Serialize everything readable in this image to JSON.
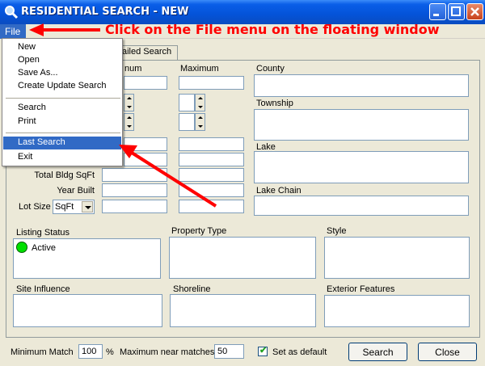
{
  "window": {
    "title": "RESIDENTIAL SEARCH - NEW",
    "icons": [
      "search-icon",
      "minimize-icon",
      "maximize-icon",
      "close-icon"
    ]
  },
  "menubar": {
    "file_label": "File"
  },
  "annotation": {
    "text": "Click on the File menu on the floating window",
    "color": "#ff0000"
  },
  "file_menu": {
    "new": "New",
    "open": "Open",
    "save_as": "Save As...",
    "create_update_search": "Create Update Search",
    "search": "Search",
    "print": "Print",
    "last_search": "Last Search",
    "exit": "Exit"
  },
  "tabs": {
    "detailed_search_partial": "ailed Search"
  },
  "form": {
    "minimum_partial": "num",
    "maximum_label": "Maximum",
    "total_bldg_sqft_label": "Total Bldg SqFt",
    "year_built_label": "Year Built",
    "lot_size_label": "Lot Size",
    "lot_size_unit": "SqFt",
    "county_label": "County",
    "township_label": "Township",
    "lake_label": "Lake",
    "lake_chain_label": "Lake Chain",
    "listing_status_label": "Listing Status",
    "listing_status_value": "Active",
    "property_type_label": "Property Type",
    "style_label": "Style",
    "site_influence_label": "Site Influence",
    "shoreline_label": "Shoreline",
    "exterior_features_label": "Exterior Features"
  },
  "footer": {
    "minimum_match_label": "Minimum Match",
    "minimum_match_value": "100",
    "percent_label": "%",
    "max_near_matches_label": "Maximum near matches",
    "max_near_matches_value": "50",
    "set_as_default_label": "Set as default",
    "set_as_default_checked": true,
    "search_button": "Search",
    "close_button": "Close"
  },
  "colors": {
    "titlebar": "#0453d8",
    "menu_highlight": "#316ac5",
    "status_active": "#00e000",
    "annotation": "#ff0000"
  }
}
